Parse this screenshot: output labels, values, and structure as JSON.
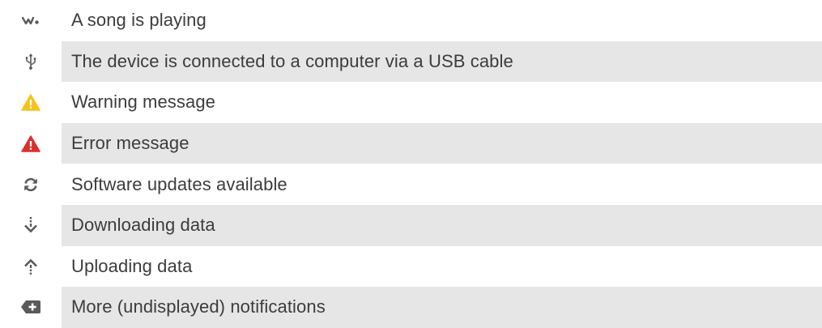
{
  "notifications": [
    {
      "icon": "walkman-icon",
      "label": "A song is playing"
    },
    {
      "icon": "usb-icon",
      "label": "The device is connected to a computer via a USB cable"
    },
    {
      "icon": "warning-icon",
      "label": "Warning message"
    },
    {
      "icon": "error-icon",
      "label": "Error message"
    },
    {
      "icon": "sync-update-icon",
      "label": "Software updates available"
    },
    {
      "icon": "download-icon",
      "label": "Downloading data"
    },
    {
      "icon": "upload-icon",
      "label": "Uploading data"
    },
    {
      "icon": "more-notifications-icon",
      "label": "More (undisplayed) notifications"
    }
  ],
  "colors": {
    "text": "#3c3c3c",
    "row_shade": "#e6e6e6",
    "icon_gray": "#5a5a5a",
    "warning": "#f6c31a",
    "error": "#d9302c"
  }
}
